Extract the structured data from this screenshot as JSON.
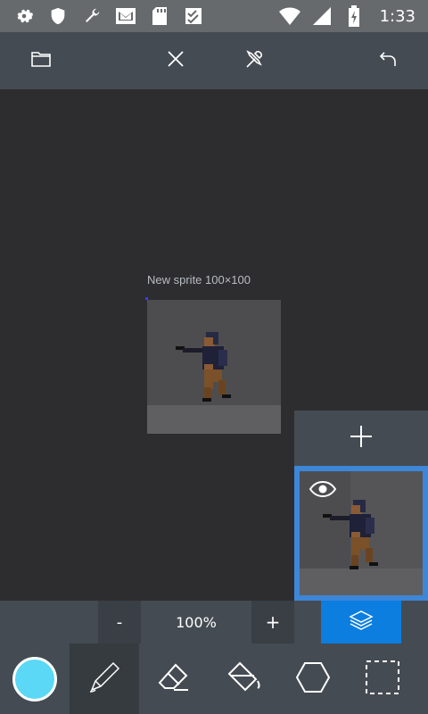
{
  "status_bar": {
    "time": "1:33",
    "icons": [
      "gear-icon",
      "shield-icon",
      "wrench-icon",
      "mail-icon",
      "sd-card-icon",
      "checklist-icon",
      "wifi-icon",
      "signal-icon",
      "battery-charging-icon"
    ]
  },
  "toolbar": {
    "buttons": [
      "folder-icon",
      "close-icon",
      "tools-icon",
      "undo-icon"
    ]
  },
  "canvas": {
    "sprite_label": "New sprite 100×100"
  },
  "layers": {
    "add_label": "+",
    "visible": true
  },
  "zoom": {
    "minus_label": "-",
    "value": "100%",
    "plus_label": "+"
  },
  "tools": {
    "primary_color": "#5ad8f6",
    "items": [
      "color-swatch",
      "pencil-icon",
      "eraser-icon",
      "bucket-fill-icon",
      "hexagon-shape-icon",
      "selection-icon"
    ],
    "active": "pencil-icon"
  },
  "colors": {
    "accent": "#0b7ee0",
    "toolbar": "#454b52",
    "background": "#2d2d2f"
  }
}
